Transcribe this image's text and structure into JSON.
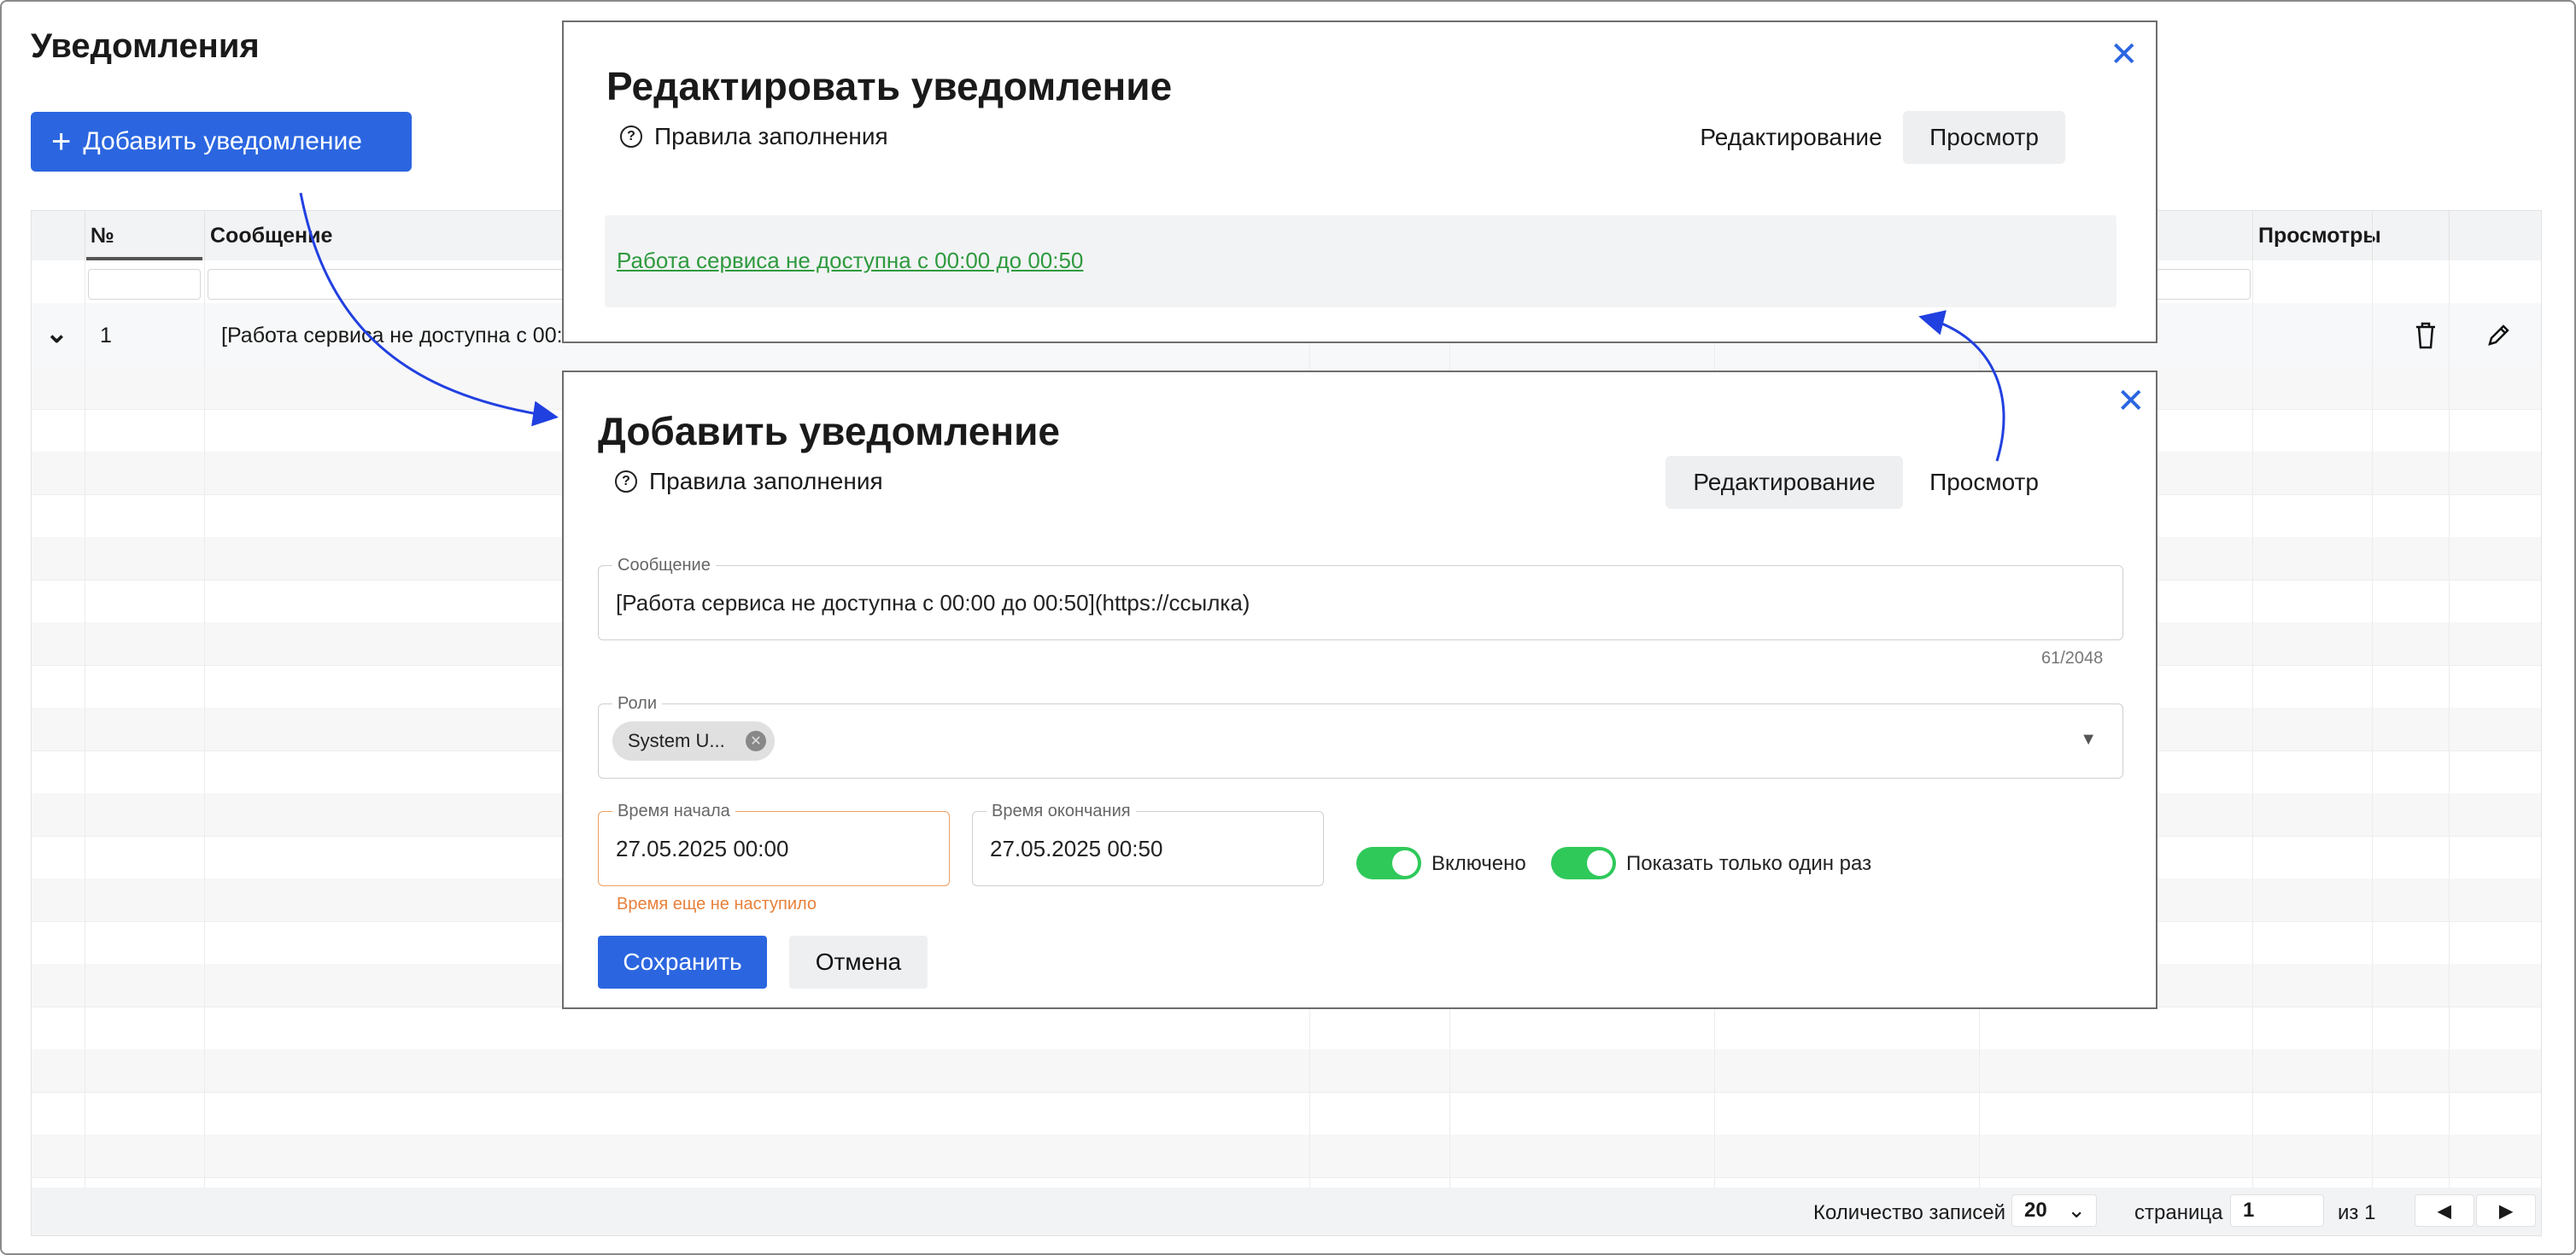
{
  "page": {
    "title": "Уведомления",
    "add_button": "Добавить уведомление"
  },
  "grid": {
    "columns": [
      "№",
      "Сообщение",
      "Просмотры"
    ],
    "row1": {
      "num": "1",
      "message": "[Работа сервиса не доступна с 00:"
    }
  },
  "pager": {
    "records_label": "Количество записей",
    "records_value": "20",
    "page_label": "страница",
    "page_value": "1",
    "of_label": "из 1"
  },
  "edit_modal": {
    "title": "Редактировать уведомление",
    "help": "Правила заполнения",
    "tab_edit": "Редактирование",
    "tab_preview": "Просмотр",
    "preview_link": "Работа сервиса не доступна с 00:00 до 00:50"
  },
  "add_modal": {
    "title": "Добавить уведомление",
    "help": "Правила заполнения",
    "tab_edit": "Редактирование",
    "tab_preview": "Просмотр",
    "message_label": "Сообщение",
    "message_value": "[Работа сервиса не доступна с 00:00 до 00:50](https://ссылка)",
    "counter": "61/2048",
    "roles_label": "Роли",
    "role_chip": "System U...",
    "start_label": "Время начала",
    "start_value": "27.05.2025 00:00",
    "start_error": "Время еще не наступило",
    "end_label": "Время окончания",
    "end_value": "27.05.2025 00:50",
    "toggle_enabled": "Включено",
    "toggle_once": "Показать только один раз",
    "save": "Сохранить",
    "cancel": "Отмена"
  },
  "colors": {
    "accent": "#2b66e0",
    "toggle_on": "#2fc95a",
    "error": "#e8803a",
    "link": "#2e9a3e"
  },
  "icons": [
    "plus-icon",
    "chevron-down-icon",
    "trash-icon",
    "pencil-icon",
    "close-icon",
    "help-icon",
    "chip-remove-icon",
    "dropdown-arrow-icon",
    "prev-page-icon",
    "next-page-icon"
  ]
}
